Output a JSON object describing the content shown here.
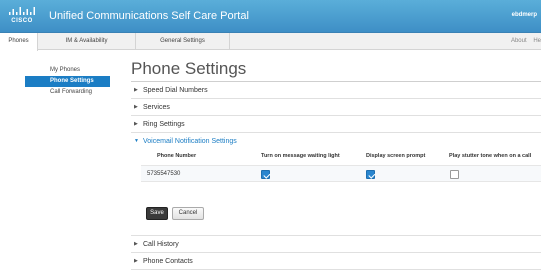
{
  "header": {
    "logo_text": "CISCO",
    "app_title": "Unified Communications Self Care Portal",
    "user": "ebdmerp"
  },
  "tabs": [
    {
      "label": "Phones",
      "active": true
    },
    {
      "label": "IM & Availability",
      "active": false
    },
    {
      "label": "General Settings",
      "active": false
    }
  ],
  "top_links": {
    "about": "About",
    "help": "He"
  },
  "sidebar": {
    "items": [
      {
        "label": "My Phones",
        "active": false
      },
      {
        "label": "Phone Settings",
        "active": true
      },
      {
        "label": "Call Forwarding",
        "active": false
      }
    ]
  },
  "main": {
    "title": "Phone Settings",
    "sections_before": [
      {
        "label": "Speed Dial Numbers"
      },
      {
        "label": "Services"
      },
      {
        "label": "Ring Settings"
      }
    ],
    "open_section": {
      "label": "Voicemail Notification Settings",
      "columns": {
        "phone_number": "Phone Number",
        "mwi": "Turn on message waiting light",
        "prompt": "Display screen prompt",
        "stutter": "Play stutter tone when on a call"
      },
      "row": {
        "phone_number": "5735547530",
        "mwi": true,
        "prompt": true,
        "stutter": false
      },
      "save_label": "Save",
      "cancel_label": "Cancel"
    },
    "sections_after": [
      {
        "label": "Call History"
      },
      {
        "label": "Phone Contacts"
      }
    ]
  },
  "icons": {
    "collapsed_arrow": "▶",
    "expanded_arrow": "▼"
  },
  "colors": {
    "header_blue": "#4a9fd2",
    "accent_blue": "#1b7dc4",
    "checkbox_blue": "#2a86cf"
  }
}
